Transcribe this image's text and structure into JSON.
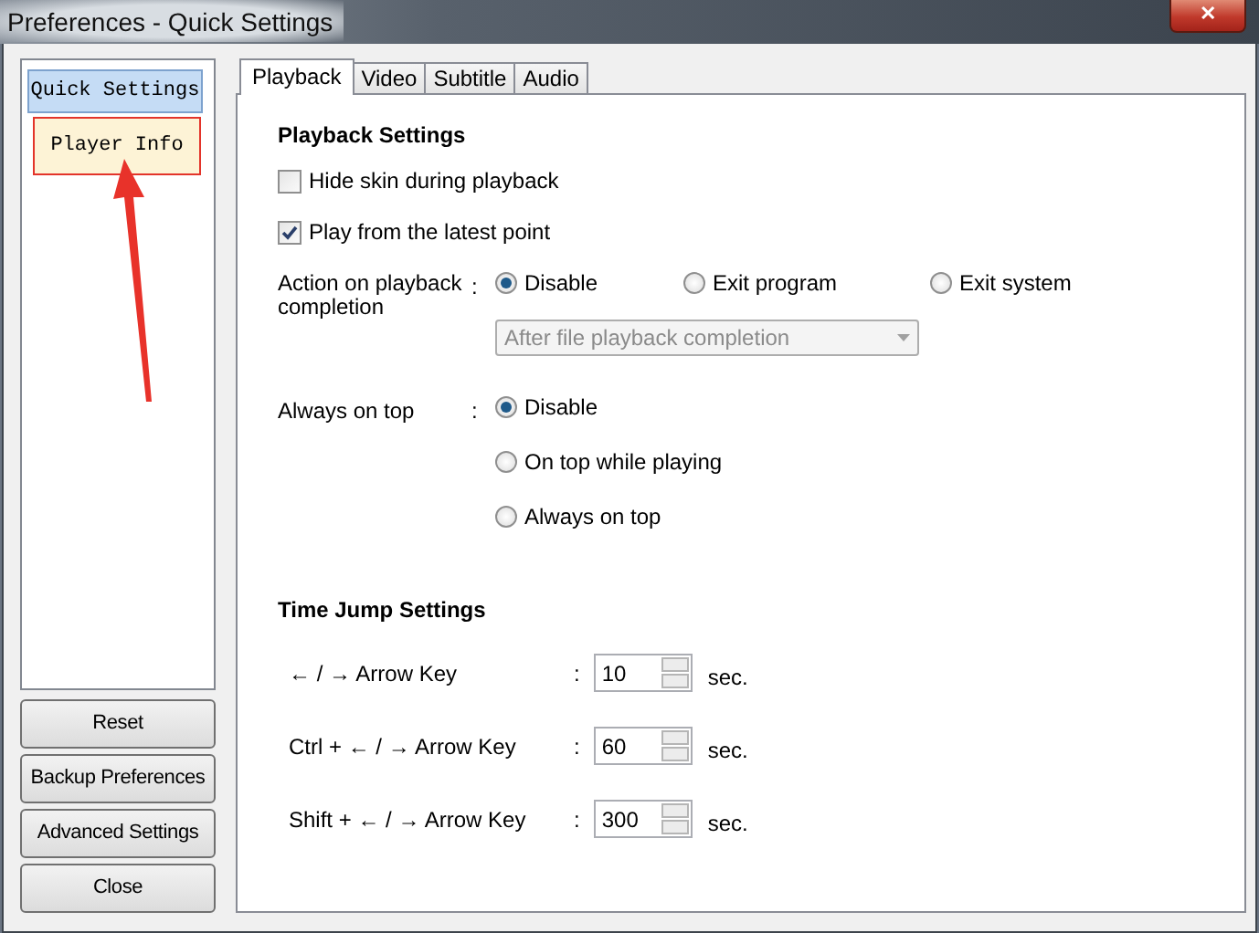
{
  "window": {
    "title": "Preferences - Quick Settings",
    "close": "✕"
  },
  "sidebar": {
    "items": [
      {
        "label": "Quick Settings",
        "selected": true,
        "annotated": false
      },
      {
        "label": "Player Info",
        "selected": false,
        "annotated": true
      }
    ]
  },
  "buttons": [
    "Reset",
    "Backup Preferences",
    "Advanced Settings",
    "Close"
  ],
  "tabs": [
    {
      "label": "Playback",
      "selected": true
    },
    {
      "label": "Video",
      "selected": false
    },
    {
      "label": "Subtitle",
      "selected": false
    },
    {
      "label": "Audio",
      "selected": false
    }
  ],
  "playback_settings": {
    "heading": "Playback Settings",
    "checkboxes": [
      {
        "label": "Hide skin during playback",
        "checked": false
      },
      {
        "label": "Play from the latest point",
        "checked": true
      }
    ],
    "action_on_completion": {
      "label": "Action on playback completion",
      "colon": ":",
      "options": [
        {
          "label": "Disable",
          "selected": true
        },
        {
          "label": "Exit program",
          "selected": false
        },
        {
          "label": "Exit system",
          "selected": false
        }
      ],
      "dropdown": {
        "value": "After file playback completion",
        "disabled": true
      }
    },
    "always_on_top": {
      "label": "Always on top",
      "colon": ":",
      "options": [
        {
          "label": "Disable",
          "selected": true
        },
        {
          "label": "On top while playing",
          "selected": false
        },
        {
          "label": "Always on top",
          "selected": false
        }
      ]
    }
  },
  "time_jump_settings": {
    "heading": "Time Jump Settings",
    "rows": [
      {
        "label": "← / → Arrow Key",
        "colon": ":",
        "value": "10",
        "unit": "sec."
      },
      {
        "label": "Ctrl + ← / → Arrow Key",
        "colon": ":",
        "value": "60",
        "unit": "sec."
      },
      {
        "label": "Shift + ← / → Arrow Key",
        "colon": ":",
        "value": "300",
        "unit": "sec."
      }
    ]
  }
}
